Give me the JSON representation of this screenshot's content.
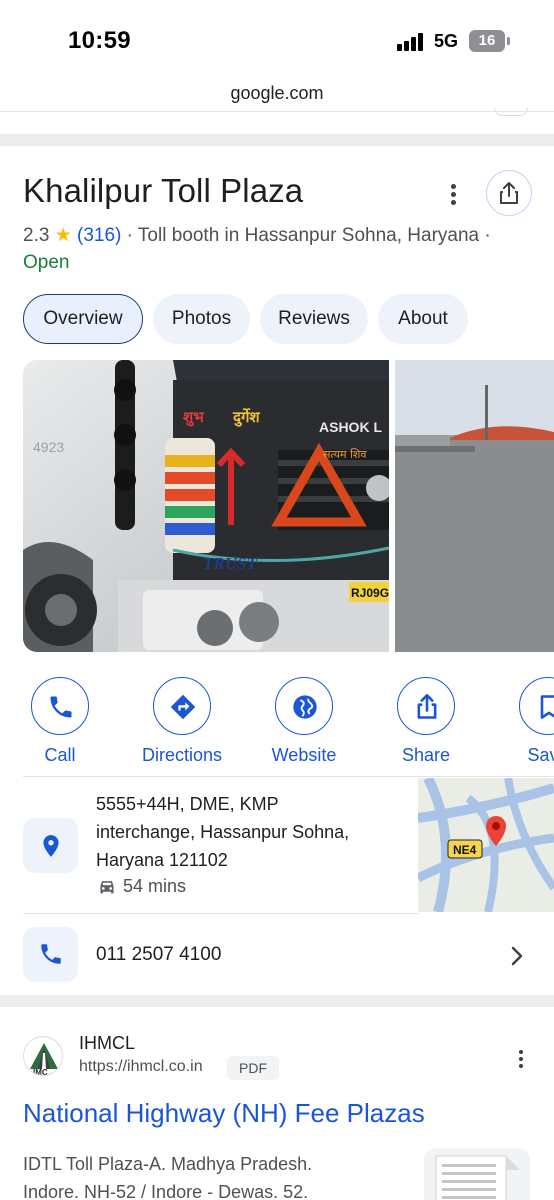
{
  "status_bar": {
    "time": "10:59",
    "network": "5G",
    "battery": "16"
  },
  "browser": {
    "url": "google.com"
  },
  "place": {
    "title": "Khalilpur Toll Plaza",
    "rating": "2.3",
    "star": "★",
    "review_count": "(316)",
    "category": "· Toll booth in Hassanpur Sohna, Haryana ·",
    "status": "Open",
    "tabs": [
      {
        "label": "Overview",
        "active": true
      },
      {
        "label": "Photos",
        "active": false
      },
      {
        "label": "Reviews",
        "active": false
      },
      {
        "label": "About",
        "active": false
      }
    ],
    "actions": [
      {
        "label": "Call",
        "icon": "phone-icon"
      },
      {
        "label": "Directions",
        "icon": "directions-icon"
      },
      {
        "label": "Website",
        "icon": "globe-icon"
      },
      {
        "label": "Share",
        "icon": "share-icon"
      },
      {
        "label": "Save",
        "icon": "bookmark-icon"
      }
    ],
    "address_lines": [
      "5555+44H, DME, KMP",
      "interchange, Hassanpur Sohna,",
      "Haryana 121102"
    ],
    "drive_time": "54 mins",
    "map_label": "NE4",
    "phone": "011 2507 4100",
    "photo_text": {
      "shubh": "शुभ",
      "durgesh": "दुर्गेश",
      "ashok": "ASHOK L",
      "satyam": "सत्यम शिव",
      "trust": "TRUST",
      "plate": "RJ09G",
      "model": "4923"
    }
  },
  "result": {
    "site_name": "IHMCL",
    "site_url": "https://ihmcl.co.in",
    "badge": "PDF",
    "logo_text": "IMC",
    "title": "National Highway (NH) Fee Plazas",
    "snippet_lines": [
      "IDTL Toll Plaza-A. Madhya Pradesh.",
      "Indore. NH-52 / Indore - Dewas. 52."
    ]
  },
  "colors": {
    "accent": "#1a56d6",
    "open_green": "#188038",
    "star": "#fbbc04",
    "chip_bg": "#eef2fb"
  }
}
